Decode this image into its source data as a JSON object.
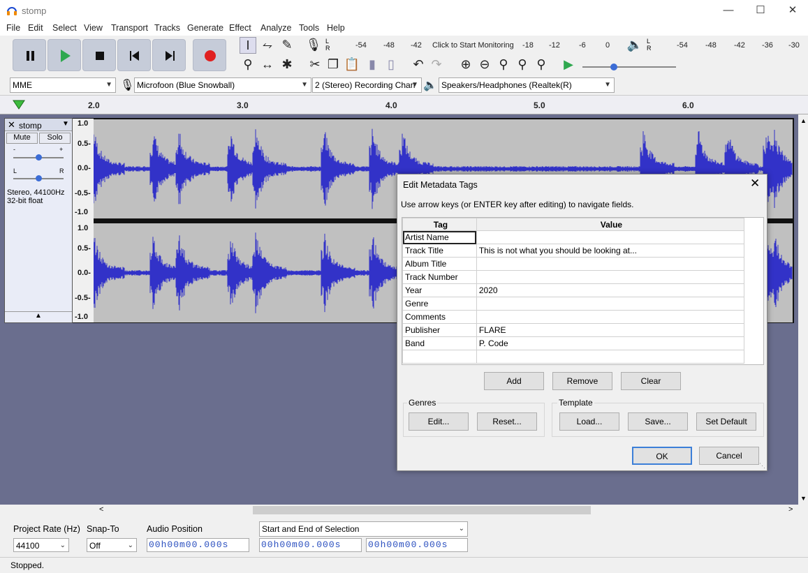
{
  "window": {
    "title": "stomp"
  },
  "menus": [
    "File",
    "Edit",
    "Select",
    "View",
    "Transport",
    "Tracks",
    "Generate",
    "Effect",
    "Analyze",
    "Tools",
    "Help"
  ],
  "meters": {
    "record_ticks": [
      "-54",
      "-48",
      "-42",
      "Click to Start Monitoring",
      "-18",
      "-12",
      "-6",
      "0"
    ],
    "play_ticks": [
      "-54",
      "-48",
      "-42",
      "-36",
      "-30"
    ],
    "lr": "L R"
  },
  "devices": {
    "host": "MME",
    "input": "Microfoon (Blue Snowball)",
    "channels": "2 (Stereo) Recording Chan",
    "output": "Speakers/Headphones (Realtek(R)"
  },
  "ruler": [
    "2.0",
    "3.0",
    "4.0",
    "5.0",
    "6.0"
  ],
  "track": {
    "name": "stomp",
    "mute": "Mute",
    "solo": "Solo",
    "info1": "Stereo, 44100Hz",
    "info2": "32-bit float",
    "gain_minus": "-",
    "gain_plus": "+",
    "pan_l": "L",
    "pan_r": "R",
    "y_labels": [
      "1.0",
      "0.5-",
      "0.0-",
      "-0.5-",
      "-1.0"
    ]
  },
  "dialog": {
    "title": "Edit Metadata Tags",
    "instruction": "Use arrow keys (or ENTER key after editing) to navigate fields.",
    "col_tag": "Tag",
    "col_value": "Value",
    "rows": [
      {
        "tag": "Artist Name",
        "value": ""
      },
      {
        "tag": "Track Title",
        "value": "This is not what you should be looking at..."
      },
      {
        "tag": "Album Title",
        "value": ""
      },
      {
        "tag": "Track Number",
        "value": ""
      },
      {
        "tag": "Year",
        "value": "2020"
      },
      {
        "tag": "Genre",
        "value": ""
      },
      {
        "tag": "Comments",
        "value": ""
      },
      {
        "tag": "Publisher",
        "value": "FLARE"
      },
      {
        "tag": "Band",
        "value": "P. Code"
      },
      {
        "tag": "",
        "value": ""
      }
    ],
    "add": "Add",
    "remove": "Remove",
    "clear": "Clear",
    "genres_label": "Genres",
    "genres_edit": "Edit...",
    "genres_reset": "Reset...",
    "template_label": "Template",
    "load": "Load...",
    "save": "Save...",
    "set_default": "Set Default",
    "ok": "OK",
    "cancel": "Cancel"
  },
  "bottom": {
    "project_rate_label": "Project Rate (Hz)",
    "project_rate": "44100",
    "snap_label": "Snap-To",
    "snap": "Off",
    "audio_pos_label": "Audio Position",
    "audio_pos": "00h00m00.000s",
    "selection_mode": "Start and End of Selection",
    "sel_start": "00h00m00.000s",
    "sel_end": "00h00m00.000s",
    "status": "Stopped."
  }
}
